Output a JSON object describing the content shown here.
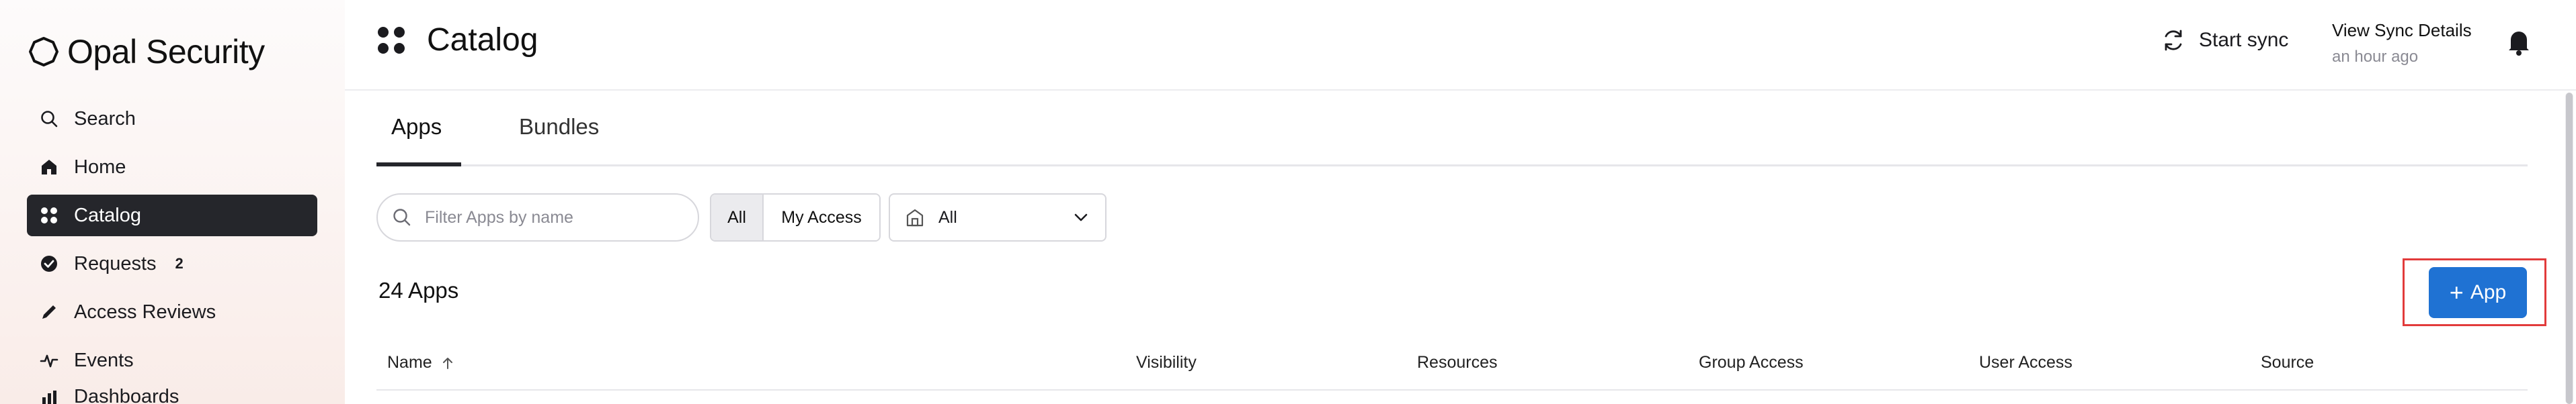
{
  "brand": {
    "name": "Opal Security"
  },
  "sidebar": {
    "items": [
      {
        "label": "Search",
        "icon": "search-icon"
      },
      {
        "label": "Home",
        "icon": "home-icon"
      },
      {
        "label": "Catalog",
        "icon": "grid-icon",
        "active": true
      },
      {
        "label": "Requests",
        "icon": "check-circle-icon",
        "badge": "2"
      },
      {
        "label": "Access Reviews",
        "icon": "pencil-icon"
      },
      {
        "label": "Events",
        "icon": "activity-icon"
      },
      {
        "label": "Dashboards",
        "icon": "chart-icon"
      }
    ]
  },
  "header": {
    "title": "Catalog",
    "sync_label": "Start sync",
    "sync_details_label": "View Sync Details",
    "sync_time": "an hour ago"
  },
  "tabs": [
    {
      "label": "Apps",
      "active": true
    },
    {
      "label": "Bundles",
      "active": false
    }
  ],
  "filters": {
    "search_placeholder": "Filter Apps by name",
    "segments": [
      {
        "label": "All",
        "selected": true
      },
      {
        "label": "My Access",
        "selected": false
      }
    ],
    "select_value": "All"
  },
  "summary": {
    "count_label": "24 Apps"
  },
  "actions": {
    "add_label": "App"
  },
  "table": {
    "columns": [
      "Name",
      "Visibility",
      "Resources",
      "Group Access",
      "User Access",
      "Source"
    ],
    "sort": {
      "column": "Name",
      "direction": "ascending"
    }
  },
  "colors": {
    "primary_button": "#1f72d3",
    "active_nav_bg": "#25262b",
    "highlight_border": "#e23b3b"
  }
}
